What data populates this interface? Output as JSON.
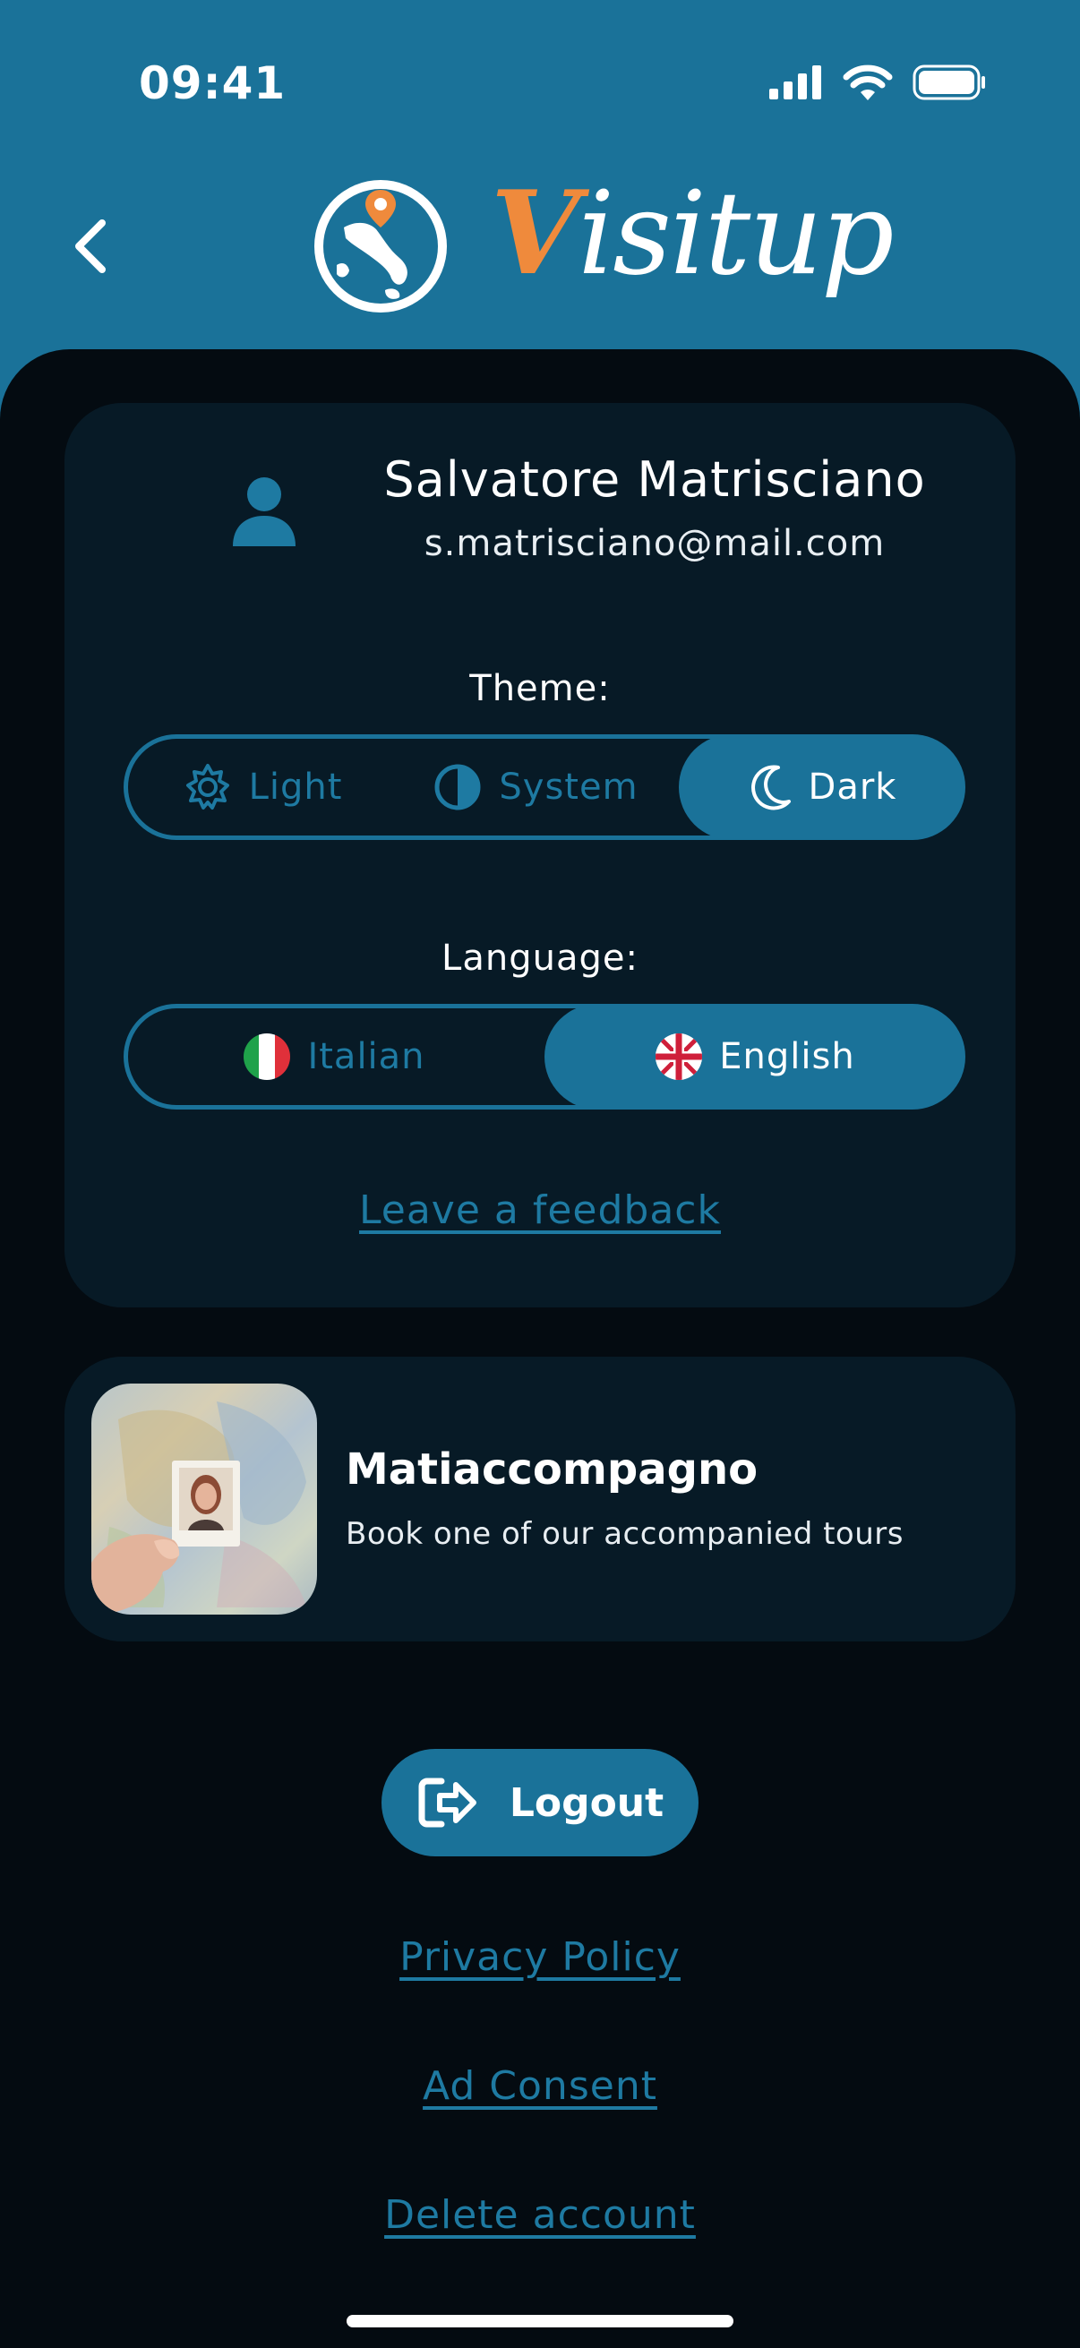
{
  "status_bar": {
    "time": "09:41"
  },
  "header": {
    "brand_initial": "V",
    "brand_rest": "isitup"
  },
  "profile": {
    "name": "Salvatore Matrisciano",
    "email": "s.matrisciano@mail.com"
  },
  "theme": {
    "label": "Theme:",
    "options": [
      {
        "label": "Light",
        "icon": "sun-icon"
      },
      {
        "label": "System",
        "icon": "half-circle-icon"
      },
      {
        "label": "Dark",
        "icon": "moon-icon"
      }
    ],
    "selected": "Dark"
  },
  "language": {
    "label": "Language:",
    "options": [
      {
        "label": "Italian",
        "icon": "italy-flag-icon"
      },
      {
        "label": "English",
        "icon": "uk-flag-icon"
      }
    ],
    "selected": "English"
  },
  "feedback_link": "Leave a feedback",
  "promo": {
    "title": "Matiaccompagno",
    "subtitle": "Book one of our accompanied tours"
  },
  "logout_label": "Logout",
  "links": {
    "privacy": "Privacy Policy",
    "ad_consent": "Ad Consent",
    "delete_account": "Delete account"
  },
  "colors": {
    "header_bg": "#1a7299",
    "sheet_bg": "#040b11",
    "card_bg": "#071a26",
    "accent": "#1a7299",
    "brand_orange": "#ef8a3c"
  }
}
